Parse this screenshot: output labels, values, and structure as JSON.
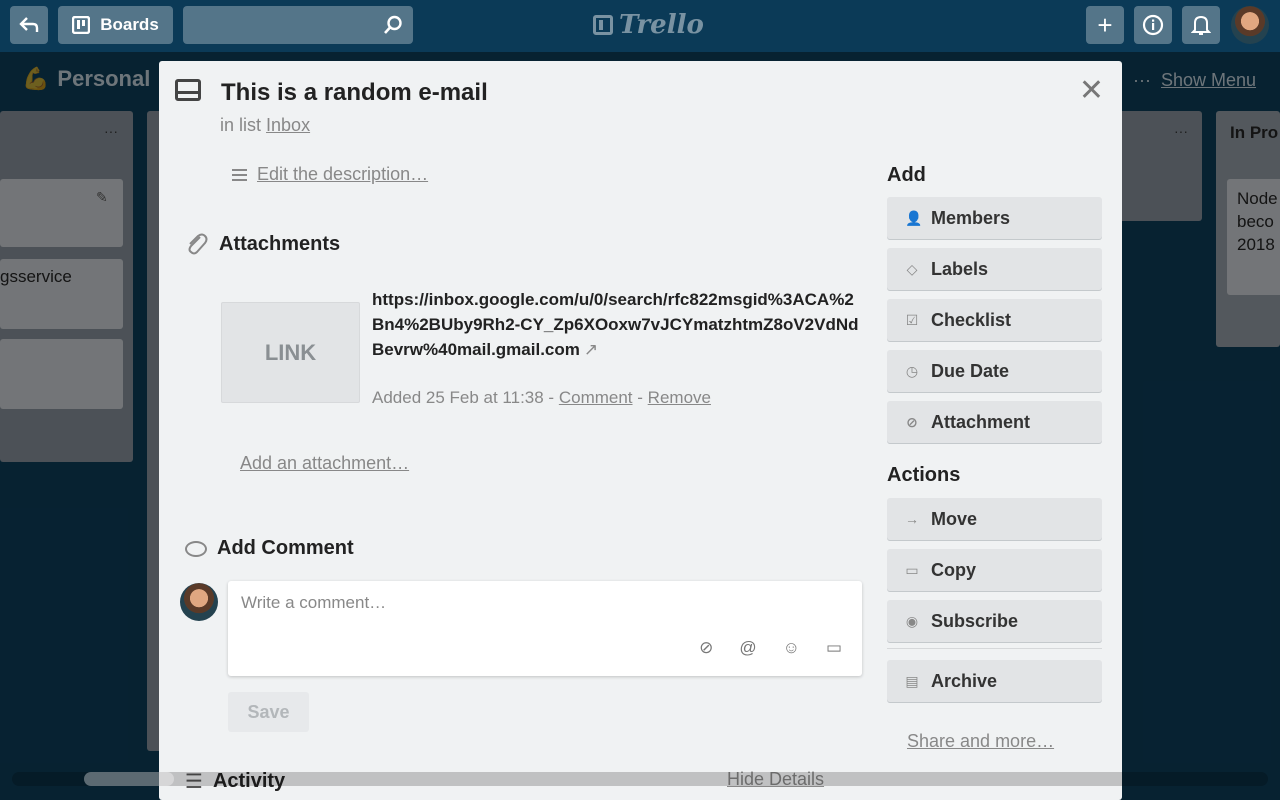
{
  "app": {
    "logo_text": "Trello",
    "boards_label": "Boards"
  },
  "board": {
    "title": "Personal",
    "show_menu": "Show Menu",
    "menu_dots": "···"
  },
  "background_lists": [
    {
      "card_text": "gsservice"
    },
    {
      "title": "In Pro",
      "card_text": "Node beco 2018"
    }
  ],
  "card": {
    "title": "This is a random e-mail",
    "in_list_prefix": "in list",
    "list_name": "Inbox",
    "edit_description": "Edit the description…",
    "attachments_heading": "Attachments",
    "attachment": {
      "thumb_label": "LINK",
      "url": "https://inbox.google.com/u/0/search/rfc822msgid%3ACA%2Bn4%2BUby9Rh2-CY_Zp6XOoxw7vJCYmatzhtmZ8oV2VdNdBevrw%40mail.gmail.com",
      "added": "Added 25 Feb at 11:38 -",
      "comment_link": "Comment",
      "separator": "-",
      "remove_link": "Remove"
    },
    "add_attachment": "Add an attachment…",
    "add_comment_heading": "Add Comment",
    "comment_placeholder": "Write a comment…",
    "save_label": "Save",
    "activity_heading": "Activity",
    "hide_details": "Hide Details"
  },
  "sidebar": {
    "add_heading": "Add",
    "add_buttons": [
      {
        "label": "Members",
        "icon": "person-icon"
      },
      {
        "label": "Labels",
        "icon": "tag-icon"
      },
      {
        "label": "Checklist",
        "icon": "checkbox-icon"
      },
      {
        "label": "Due Date",
        "icon": "clock-icon"
      },
      {
        "label": "Attachment",
        "icon": "paperclip-icon"
      }
    ],
    "actions_heading": "Actions",
    "action_buttons": [
      {
        "label": "Move",
        "icon": "arrow-right-icon"
      },
      {
        "label": "Copy",
        "icon": "card-icon"
      },
      {
        "label": "Subscribe",
        "icon": "eye-icon"
      },
      {
        "label": "Archive",
        "icon": "archive-icon"
      }
    ],
    "share_more": "Share and more…"
  }
}
